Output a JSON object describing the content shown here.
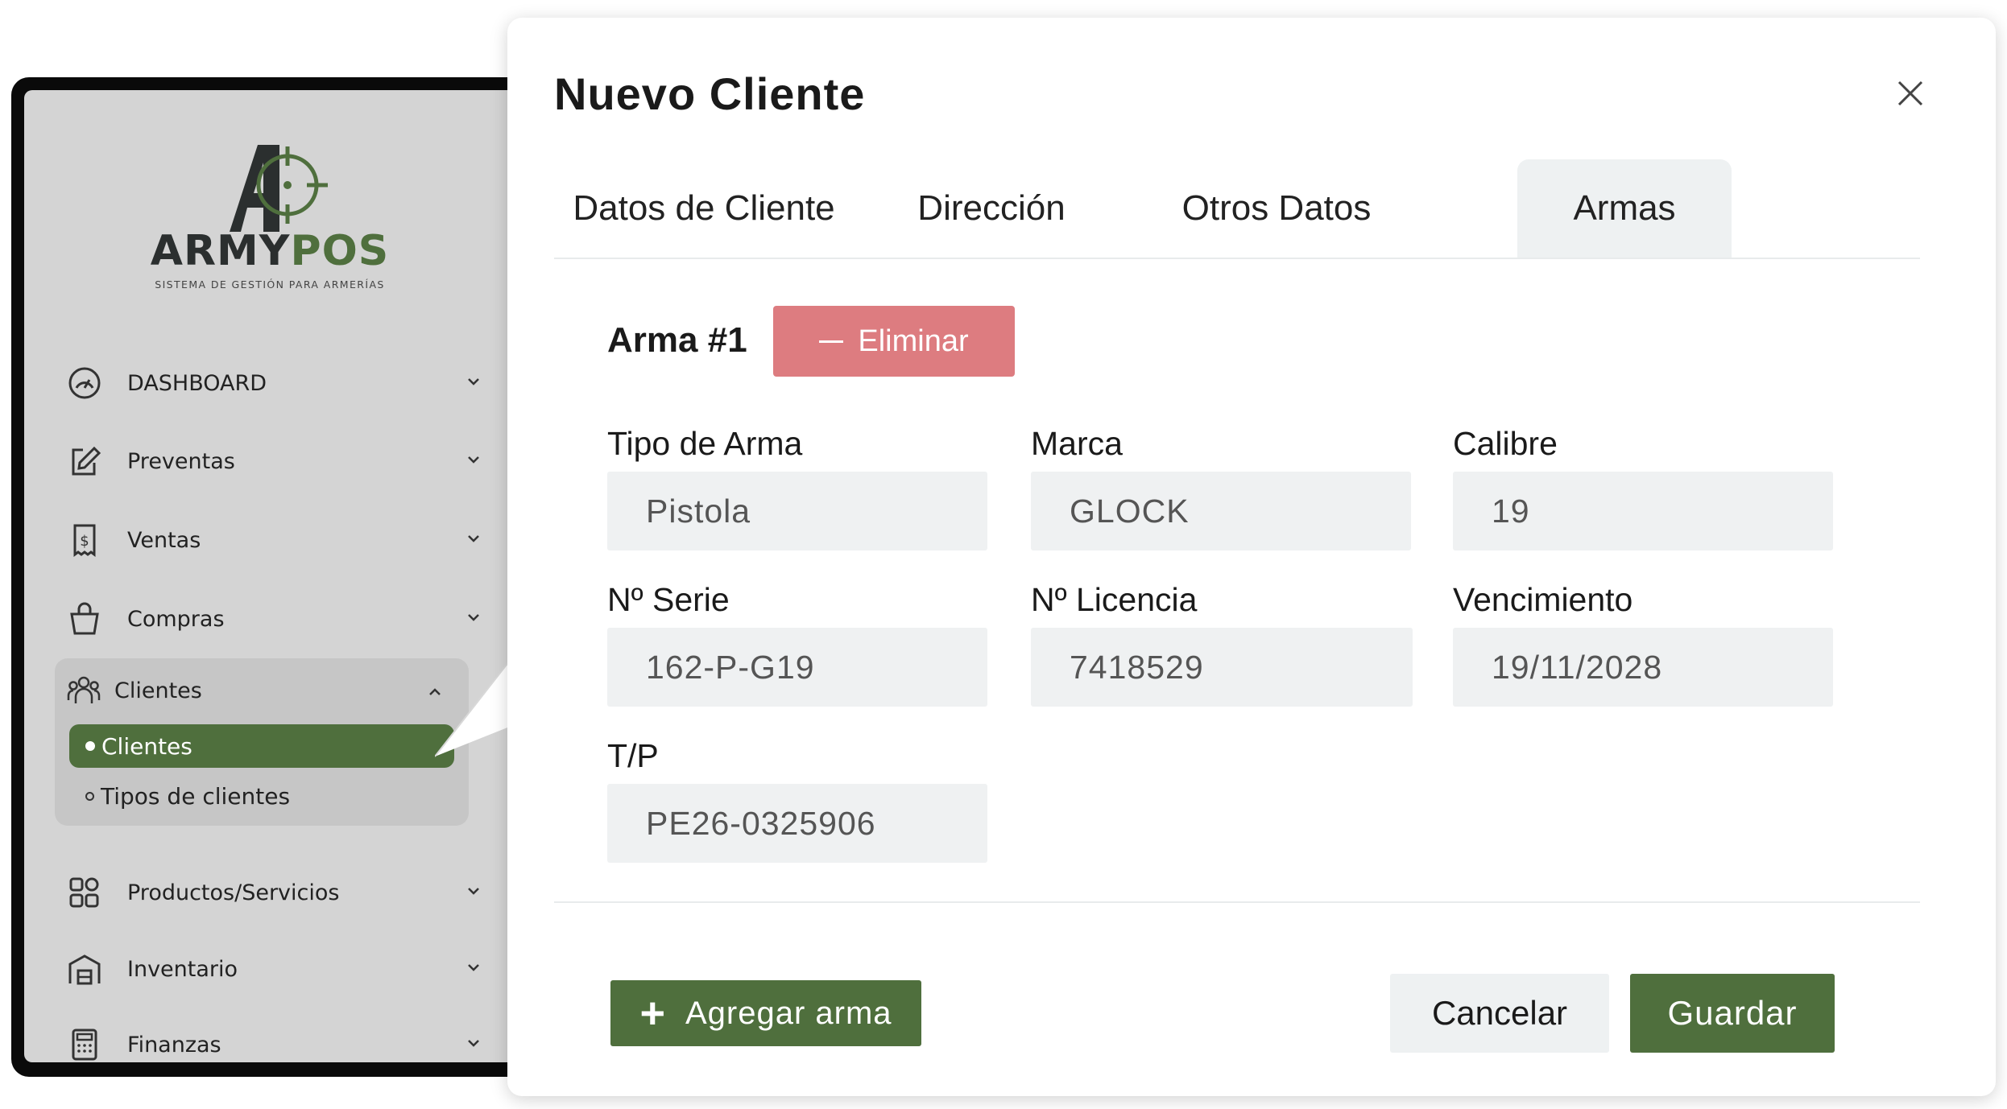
{
  "brand": {
    "name_part1": "ARMY",
    "name_part2": "POS",
    "tagline": "SISTEMA DE GESTIÓN PARA ARMERÍAS",
    "colors": {
      "primary": "#4f6f3d",
      "danger": "#dd7c80",
      "dark": "#2b2f2f"
    }
  },
  "sidebar": {
    "items": [
      {
        "label": "DASHBOARD",
        "icon": "dashboard-gauge-icon"
      },
      {
        "label": "Preventas",
        "icon": "edit-pencil-icon"
      },
      {
        "label": "Ventas",
        "icon": "receipt-dollar-icon"
      },
      {
        "label": "Compras",
        "icon": "shopping-bag-icon"
      },
      {
        "label": "Productos/Servicios",
        "icon": "grid-icon"
      },
      {
        "label": "Inventario",
        "icon": "warehouse-icon"
      },
      {
        "label": "Finanzas",
        "icon": "calculator-icon"
      }
    ],
    "clients_group": {
      "label": "Clientes",
      "icon": "users-icon",
      "sub_items": [
        {
          "label": "Clientes",
          "active": true
        },
        {
          "label": "Tipos de clientes",
          "active": false
        }
      ]
    }
  },
  "modal": {
    "title": "Nuevo Cliente",
    "tabs": [
      {
        "label": "Datos de Cliente",
        "active": false
      },
      {
        "label": "Dirección",
        "active": false
      },
      {
        "label": "Otros Datos",
        "active": false
      },
      {
        "label": "Armas",
        "active": true
      }
    ],
    "weapon": {
      "title": "Arma #1",
      "delete_label": "Eliminar",
      "fields": {
        "tipo": {
          "label": "Tipo de Arma",
          "value": "Pistola"
        },
        "marca": {
          "label": "Marca",
          "value": "GLOCK"
        },
        "calibre": {
          "label": "Calibre",
          "value": "19"
        },
        "serie": {
          "label": "Nº Serie",
          "value": "162-P-G19"
        },
        "licencia": {
          "label": "Nº Licencia",
          "value": "7418529"
        },
        "vencimiento": {
          "label": "Vencimiento",
          "value": "19/11/2028"
        },
        "tp": {
          "label": "T/P",
          "value": "PE26-0325906"
        }
      }
    },
    "add_weapon_label": "Agregar arma",
    "cancel_label": "Cancelar",
    "save_label": "Guardar"
  }
}
